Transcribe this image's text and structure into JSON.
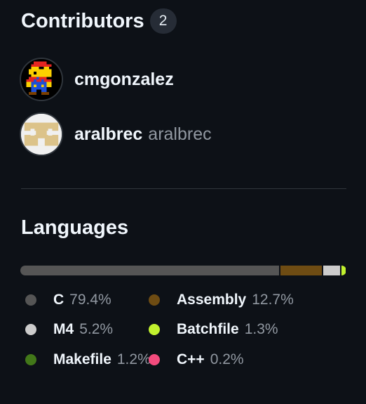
{
  "contributors": {
    "title": "Contributors",
    "count": "2",
    "people": [
      {
        "handle": "cmgonzalez",
        "name": ""
      },
      {
        "handle": "aralbrec",
        "name": "aralbrec"
      }
    ]
  },
  "languages": {
    "title": "Languages",
    "items": [
      {
        "name": "C",
        "percent": "79.4%",
        "value": 79.4,
        "color": "#555555"
      },
      {
        "name": "Assembly",
        "percent": "12.7%",
        "value": 12.7,
        "color": "#6e4c13"
      },
      {
        "name": "M4",
        "percent": "5.2%",
        "value": 5.2,
        "color": "#cccccc"
      },
      {
        "name": "Batchfile",
        "percent": "1.3%",
        "value": 1.3,
        "color": "#c1f12e"
      },
      {
        "name": "Makefile",
        "percent": "1.2%",
        "value": 1.2,
        "color": "#427819"
      },
      {
        "name": "C++",
        "percent": "0.2%",
        "value": 0.2,
        "color": "#f34b7d"
      }
    ]
  }
}
